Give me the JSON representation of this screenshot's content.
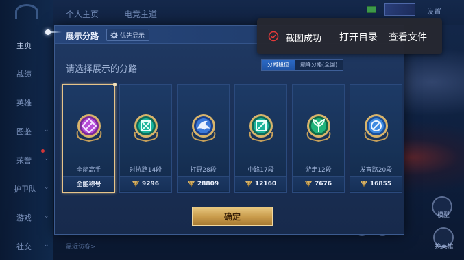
{
  "sidebar": {
    "items": [
      {
        "label": "主页",
        "active": true
      },
      {
        "label": "战绩"
      },
      {
        "label": "英雄"
      },
      {
        "label": "图鉴"
      },
      {
        "label": "荣誉"
      },
      {
        "label": "护卫队"
      },
      {
        "label": "游戏"
      },
      {
        "label": "社交"
      }
    ]
  },
  "topbar": {
    "tabs": [
      "个人主页",
      "电竞主道"
    ],
    "settings_label": "设置"
  },
  "right_panel": {
    "label1": "模型",
    "label2": "换英雄"
  },
  "bottom": {
    "recent_label": "最近访客>"
  },
  "modal": {
    "title": "展示分路",
    "priority_badge": "优先显示",
    "prompt": "请选择展示的分路",
    "segment": {
      "options": [
        "分路段位",
        "巅峰分路(全国)"
      ],
      "selected": "分路段位"
    },
    "cards": [
      {
        "name": "全能高手",
        "footer_title": "全能称号",
        "selected": true,
        "emblem": "allround-emblem-icon"
      },
      {
        "name": "对抗路14段",
        "points": "9296",
        "emblem": "clash-lane-emblem-icon"
      },
      {
        "name": "打野28段",
        "points": "28809",
        "emblem": "jungle-emblem-icon"
      },
      {
        "name": "中路17段",
        "points": "12160",
        "emblem": "mid-lane-emblem-icon"
      },
      {
        "name": "游走12段",
        "points": "7676",
        "emblem": "roam-emblem-icon"
      },
      {
        "name": "发育路20段",
        "points": "16855",
        "emblem": "farm-lane-emblem-icon"
      }
    ],
    "confirm_label": "确定"
  },
  "toast": {
    "message": "截图成功",
    "open_folder": "打开目录",
    "view_file": "查看文件"
  },
  "colors": {
    "accent_gold": "#e6c48a",
    "segment_active": "#2c6bc7",
    "toast_ok": "#e23a3a"
  }
}
